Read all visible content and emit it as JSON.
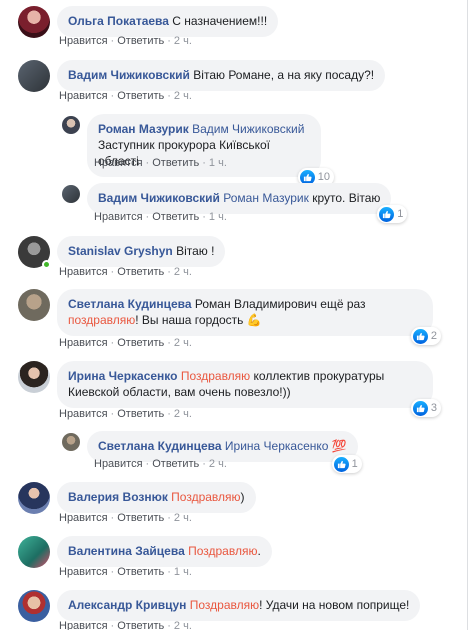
{
  "actions": {
    "like": "Нравится",
    "reply": "Ответить",
    "sep": "·"
  },
  "comments": [
    {
      "name": "Ольга Покатаева",
      "text": "С назначением!!!",
      "time": "2 ч."
    },
    {
      "name": "Вадим Чижиковский",
      "text": "Вітаю Романе, а на яку посаду?!",
      "time": "2 ч."
    },
    {
      "name": "Роман Мазурик",
      "mention": "Вадим Чижиковский",
      "text": "Заступник прокурора Київської області",
      "time": "1 ч.",
      "reactions": "10"
    },
    {
      "name": "Вадим Чижиковский",
      "mention": "Роман Мазурик",
      "text": "круто. Вітаю",
      "time": "1 ч.",
      "reactions": "1"
    },
    {
      "name": "Stanislav Gryshyn",
      "text": "Вітаю !",
      "time": "2 ч."
    },
    {
      "name": "Светлана Кудинцева",
      "text_before": "Роман Владимирович ещё раз",
      "highlight": "поздравляю",
      "text_after": "! Вы наша гордость",
      "emoji": "💪",
      "time": "2 ч.",
      "reactions": "2"
    },
    {
      "name": "Ирина Черкасенко",
      "highlight": "Поздравляю",
      "text_after": "коллектив прокуратуры Киевской области, вам очень повезло!))",
      "time": "2 ч.",
      "reactions": "3"
    },
    {
      "name": "Светлана Кудинцева",
      "mention": "Ирина Черкасенко",
      "emoji": "💯",
      "time": "2 ч.",
      "reactions": "1"
    },
    {
      "name": "Валерия Вознюк",
      "highlight": "Поздравляю",
      "text_after": ")",
      "time": "2 ч."
    },
    {
      "name": "Валентина Зайцева",
      "highlight": "Поздравляю",
      "text_after": ".",
      "time": "1 ч."
    },
    {
      "name": "Александр Кривцун",
      "highlight": "Поздравляю",
      "text_after": "! Удачи на новом поприще!",
      "time": "2 ч."
    }
  ],
  "colors": {
    "link": "#385898",
    "highlight": "#e9573f",
    "bubble": "#f2f3f5",
    "like_blue": "#1877f2",
    "online": "#42b72a"
  },
  "icons": {
    "reaction": "like-icon"
  }
}
